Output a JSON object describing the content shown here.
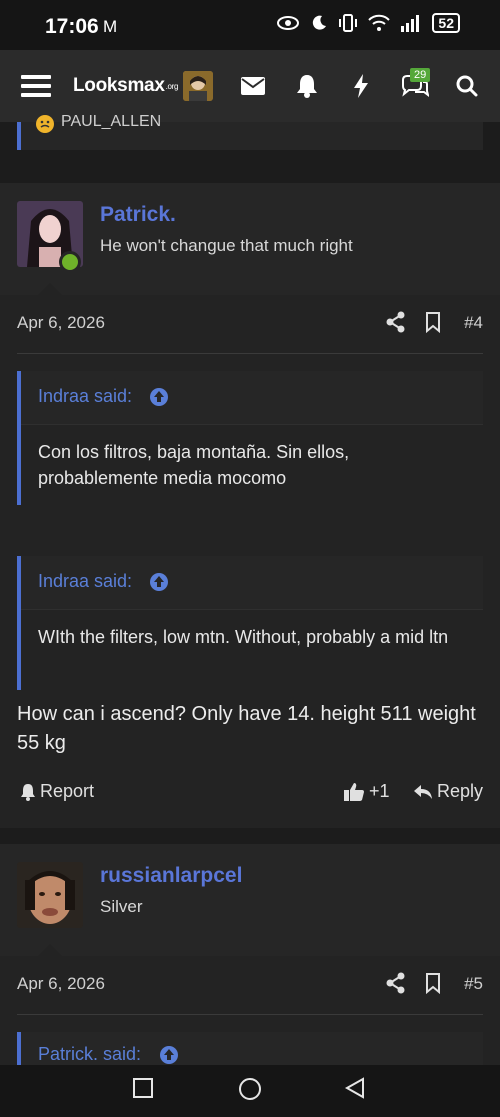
{
  "status_bar": {
    "time": "17:06",
    "mail_glyph": "M",
    "battery": "52",
    "icons": [
      "eye-icon",
      "moon-icon",
      "vibrate-icon",
      "wifi-icon",
      "signal-icon",
      "battery-icon"
    ]
  },
  "navbar": {
    "logo_main": "Looksmax",
    "logo_suffix": ".org",
    "notification_badge": "29",
    "icons": [
      "menu-icon",
      "avatar",
      "mail-icon",
      "bell-icon",
      "bolt-icon",
      "chat-icon",
      "search-icon"
    ]
  },
  "previous_post": {
    "quote_user": "PAUL_ALLEN"
  },
  "posts": [
    {
      "username": "Patrick.",
      "user_title": "He won't changue that much right",
      "date": "Apr 6, 2026",
      "number": "#4",
      "quotes": [
        {
          "attribution": "Indraa said:",
          "body": "Con los filtros, baja montaña. Sin ellos, probablemente media mocomo"
        },
        {
          "attribution": "Indraa said:",
          "body": "WIth the filters, low mtn. Without, probably a mid ltn"
        }
      ],
      "text": "How can i ascend? Only have 14. height 511 weight 55 kg",
      "actions": {
        "report": "Report",
        "like_count": "+1",
        "reply": "Reply"
      }
    },
    {
      "username": "russianlarpcel",
      "user_title": "Silver",
      "date": "Apr 6, 2026",
      "number": "#5",
      "quotes": [
        {
          "attribution": "Patrick. said:"
        }
      ]
    }
  ],
  "colors": {
    "accent": "#5a76d8",
    "quote_bar": "#4c6fd1",
    "online": "#6fb32a",
    "badge": "#55a83a"
  }
}
